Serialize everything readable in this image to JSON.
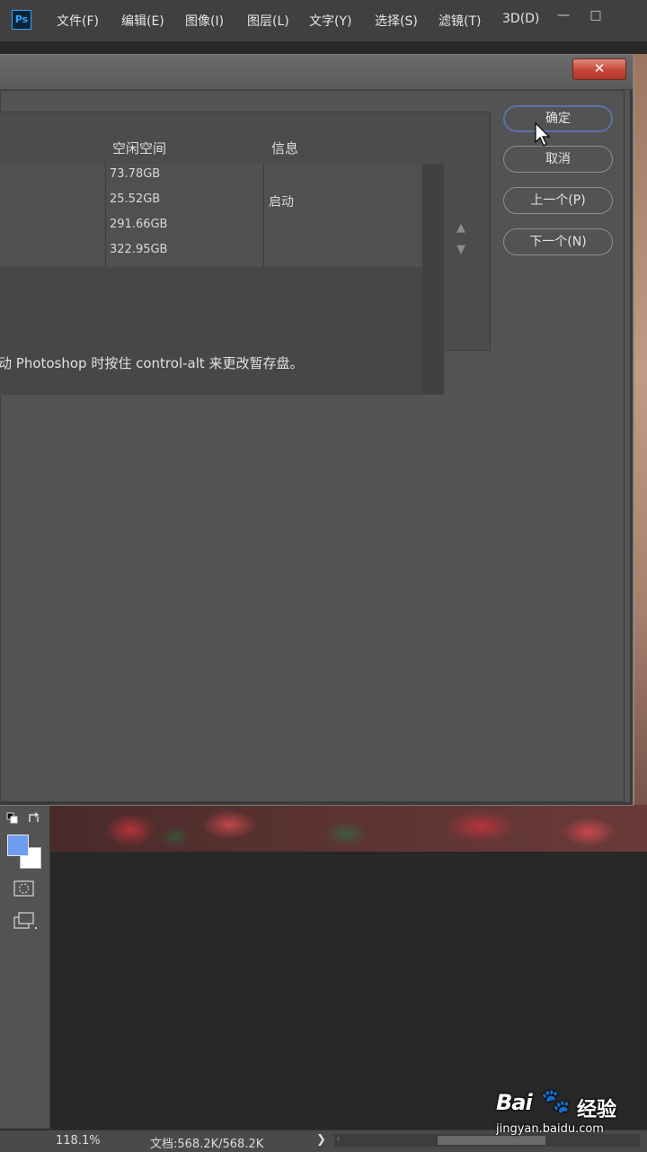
{
  "app": {
    "logo": "Ps",
    "menu": [
      "文件(F)",
      "编辑(E)",
      "图像(I)",
      "图层(L)",
      "文字(Y)",
      "选择(S)",
      "滤镜(T)",
      "3D(D)"
    ],
    "window_controls": {
      "minimize": "—",
      "maximize": "□"
    }
  },
  "dialog": {
    "close_label": "✕",
    "columns": {
      "free_space": "空闲空间",
      "info": "信息"
    },
    "disks": [
      {
        "free_space": "73.78GB",
        "info": ""
      },
      {
        "free_space": "25.52GB",
        "info": "启动"
      },
      {
        "free_space": "291.66GB",
        "info": ""
      },
      {
        "free_space": "322.95GB",
        "info": ""
      }
    ],
    "scroll_up": "▲",
    "scroll_down": "▼",
    "hint": "动 Photoshop 时按住 control-alt 来更改暂存盘。",
    "buttons": {
      "ok": "确定",
      "cancel": "取消",
      "prev": "上一个(P)",
      "next": "下一个(N)"
    }
  },
  "colors": {
    "foreground": "#6d9cf0",
    "background": "#ffffff",
    "primary_border": "#5a73a8"
  },
  "statusbar": {
    "zoom": "118.1%",
    "doc": "文档:568.2K/568.2K",
    "arrow": "❯",
    "scroll_left": "‹"
  },
  "watermark": {
    "logo": "Bai",
    "paw": "🐾",
    "text": "经验",
    "url": "jingyan.baidu.com"
  }
}
